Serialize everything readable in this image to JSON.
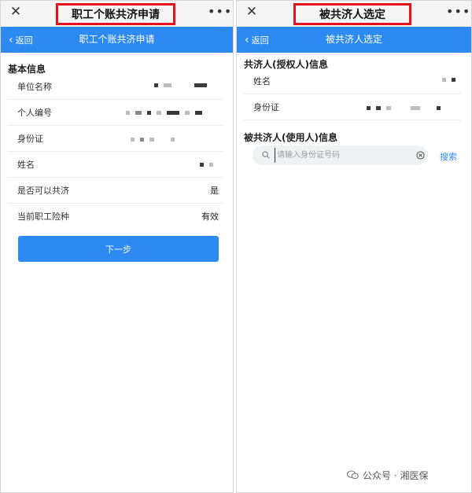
{
  "left_screen": {
    "window_title": "职工个账共济申请",
    "nav": {
      "back_label": "返回",
      "title": "职工个账共济申请"
    },
    "section_title": "基本信息",
    "rows": [
      {
        "label": "单位名称",
        "value": ""
      },
      {
        "label": "个人编号",
        "value": ""
      },
      {
        "label": "身份证",
        "value": ""
      },
      {
        "label": "姓名",
        "value": ""
      },
      {
        "label": "是否可以共济",
        "value": "是"
      },
      {
        "label": "当前职工险种",
        "value": "有效"
      }
    ],
    "next_button": "下一步"
  },
  "right_screen": {
    "window_title": "被共济人选定",
    "nav": {
      "back_label": "返回",
      "title": "被共济人选定"
    },
    "authorizer_section": "共济人(授权人)信息",
    "authorizer_rows": [
      {
        "label": "姓名",
        "value": ""
      },
      {
        "label": "身份证",
        "value": ""
      }
    ],
    "user_section": "被共济人(使用人)信息",
    "search": {
      "placeholder": "请输入身份证号码",
      "value": "",
      "button": "搜索"
    }
  },
  "watermark": "公众号 · 湘医保",
  "icons": {
    "close": "close-icon",
    "more": "more-icon",
    "back": "chevron-left-icon",
    "search": "search-icon",
    "clear": "clear-icon",
    "watermark": "wechat-icon"
  },
  "colors": {
    "primary": "#2d8af0",
    "highlight_border": "#e8101a",
    "top_bar": "#f5f5f5"
  }
}
